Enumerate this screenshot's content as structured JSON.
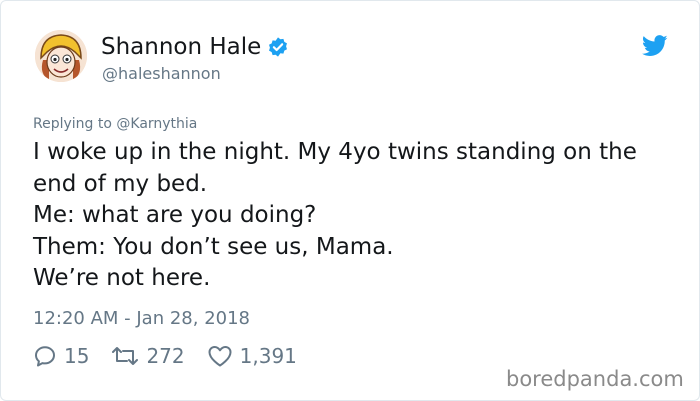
{
  "author": {
    "name": "Shannon Hale",
    "handle": "@haleshannon"
  },
  "reply_to": "Replying to @Karnythia",
  "tweet_lines": [
    "I woke up in the night. My 4yo twins standing on the",
    "end of my bed.",
    "Me: what are you doing?",
    "Them: You don’t see us, Mama.",
    "We’re not here."
  ],
  "timestamp": "12:20 AM - Jan 28, 2018",
  "actions": {
    "replies": "15",
    "retweets": "272",
    "likes": "1,391"
  },
  "watermark": "boredpanda.com",
  "colors": {
    "accent": "#1da1f2",
    "secondary_text": "#657786",
    "primary_text": "#14171a"
  },
  "icons": [
    "verified-badge-icon",
    "twitter-bird-icon",
    "reply-icon",
    "retweet-icon",
    "like-icon"
  ]
}
